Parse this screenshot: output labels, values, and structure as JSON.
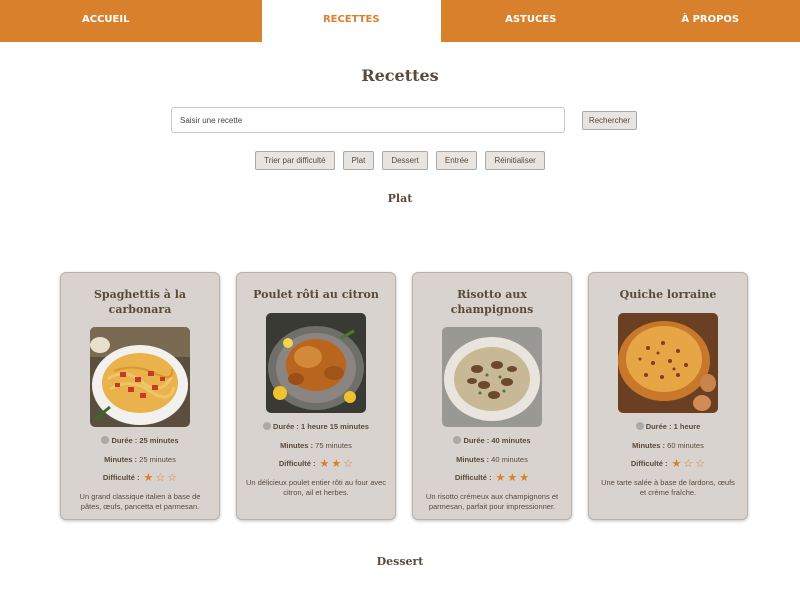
{
  "nav": {
    "tabs": [
      {
        "label": "ACCUEIL"
      },
      {
        "label": "RECETTES"
      },
      {
        "label": "ASTUCES"
      },
      {
        "label": "À PROPOS"
      }
    ]
  },
  "page_title": "Recettes",
  "search": {
    "placeholder": "Saisir une recette",
    "button_label": "Rechercher"
  },
  "filters": [
    {
      "label": "Trier par difficulté"
    },
    {
      "label": "Plat"
    },
    {
      "label": "Dessert"
    },
    {
      "label": "Entrée"
    },
    {
      "label": "Réinitialiser"
    }
  ],
  "sections": {
    "plat": "Plat",
    "dessert": "Dessert"
  },
  "labels": {
    "duree": "Durée :",
    "minutes": "Minutes :",
    "difficulte": "Difficulté :"
  },
  "recipes": [
    {
      "title": "Spaghettis à la carbonara",
      "duree": "25 minutes",
      "minutes": "25 minutes",
      "difficulty": 1,
      "max_difficulty": 3,
      "description": "Un grand classique italien à base de pâtes, œufs, pancetta et parmesan."
    },
    {
      "title": "Poulet rôti au citron",
      "duree": "1 heure 15 minutes",
      "minutes": "75 minutes",
      "difficulty": 2,
      "max_difficulty": 3,
      "description": "Un délicieux poulet entier rôti au four avec citron, ail et herbes."
    },
    {
      "title": "Risotto aux champignons",
      "duree": "40 minutes",
      "minutes": "40 minutes",
      "difficulty": 3,
      "max_difficulty": 3,
      "description": "Un risotto crémeux aux champignons et parmesan, parfait pour impressionner."
    },
    {
      "title": "Quiche lorraine",
      "duree": "1 heure",
      "minutes": "60 minutes",
      "difficulty": 1,
      "max_difficulty": 3,
      "description": "Une tarte salée à base de lardons, œufs et crème fraîche."
    }
  ],
  "colors": {
    "accent": "#d9802c",
    "card_bg": "#d9d3cf",
    "text": "#5a4a3a"
  }
}
